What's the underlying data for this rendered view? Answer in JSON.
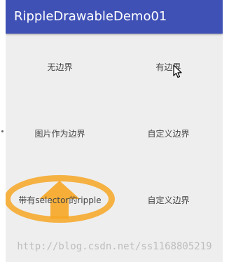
{
  "app": {
    "title": "RippleDrawableDemo01"
  },
  "buttons": [
    {
      "label": "无边界"
    },
    {
      "label": "有边界"
    },
    {
      "label": "图片作为边界"
    },
    {
      "label": "自定义边界"
    },
    {
      "label": "带有selector的ripple"
    },
    {
      "label": "自定义边界"
    }
  ],
  "watermark": "http://blog.csdn.net/ss1168805219",
  "colors": {
    "app_bar": "#3f51b5",
    "background": "#eeeeee",
    "ripple": "#f6a623"
  },
  "icons": {
    "cursor": "mouse-pointer-icon",
    "arrow": "arrow-up-icon"
  }
}
